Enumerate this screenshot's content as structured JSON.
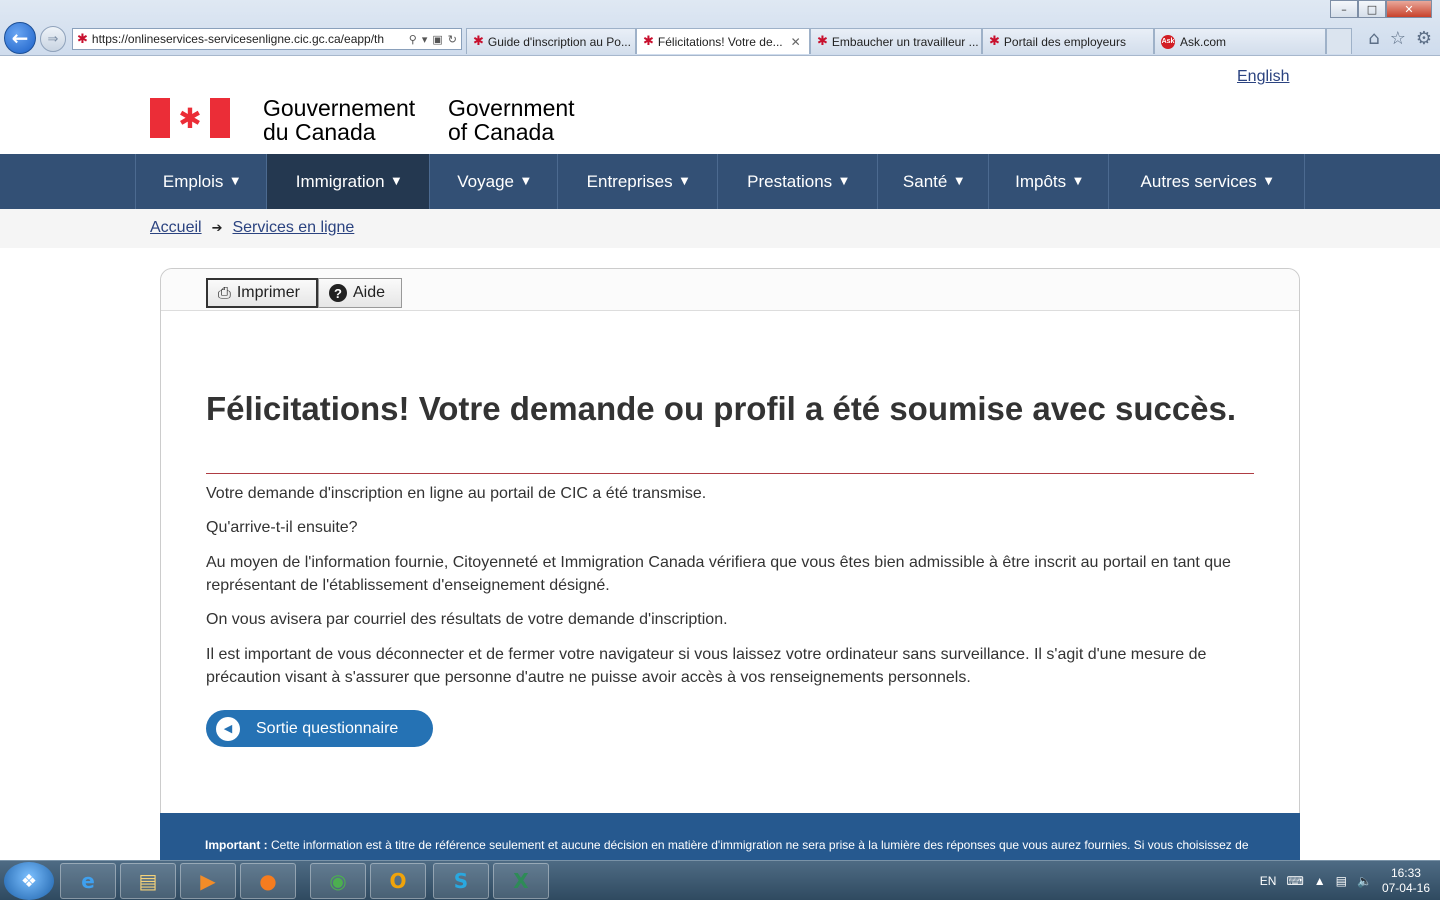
{
  "browser": {
    "url": "https://onlineservices-servicesenligne.cic.gc.ca/eapp/th",
    "tabs": [
      {
        "label": "Guide d'inscription au Po..."
      },
      {
        "label": "Félicitations! Votre de..."
      },
      {
        "label": "Embaucher un travailleur ..."
      },
      {
        "label": "Portail des employeurs"
      },
      {
        "label": "Ask.com"
      }
    ]
  },
  "header": {
    "language_link": "English",
    "signature_fr_line1": "Gouvernement",
    "signature_fr_line2": "du Canada",
    "signature_en_line1": "Government",
    "signature_en_line2": "of Canada"
  },
  "menu": {
    "items": [
      {
        "label": "Emplois"
      },
      {
        "label": "Immigration"
      },
      {
        "label": "Voyage"
      },
      {
        "label": "Entreprises"
      },
      {
        "label": "Prestations"
      },
      {
        "label": "Santé"
      },
      {
        "label": "Impôts"
      },
      {
        "label": "Autres services"
      }
    ]
  },
  "breadcrumb": {
    "home": "Accueil",
    "current": "Services en ligne"
  },
  "toolbar": {
    "print_label": "Imprimer",
    "help_label": "Aide"
  },
  "main": {
    "title": "Félicitations! Votre demande ou profil a été soumise avec succès.",
    "paragraphs": [
      "Votre demande d'inscription en ligne au portail de CIC a été transmise.",
      "Qu'arrive-t-il ensuite?",
      "Au moyen de l'information fournie, Citoyenneté et Immigration Canada vérifiera que vous êtes bien admissible à être inscrit au portail en tant que représentant de l'établissement d'enseignement désigné.",
      "On vous avisera par courriel des résultats de votre demande d'inscription.",
      "Il est important de vous déconnecter et de fermer votre navigateur si vous laissez votre ordinateur sans surveillance. Il s'agit d'une mesure de précaution visant à s'assurer que personne d'autre ne puisse avoir accès à vos renseignements personnels."
    ],
    "exit_button": "Sortie questionnaire"
  },
  "important": {
    "label": "Important :",
    "text": "Cette information est à titre de référence seulement et aucune décision en matière d'immigration ne sera prise à la lumière des réponses que vous aurez fournies. Si vous choisissez de"
  },
  "taskbar": {
    "language": "EN",
    "time": "16:33",
    "date": "07-04-16"
  },
  "colors": {
    "menu_bg": "#335075",
    "menu_active": "#243850",
    "link": "#2b4380",
    "title_rule": "#af3c43",
    "exit_button": "#2572b4",
    "important_bg": "#26598f"
  },
  "icons": {
    "back": "back-arrow-icon",
    "forward": "forward-arrow-icon",
    "print": "printer-icon",
    "help": "question-icon",
    "exit": "left-triangle-icon",
    "home": "home-icon",
    "favorites": "star-icon",
    "settings": "gear-icon"
  }
}
